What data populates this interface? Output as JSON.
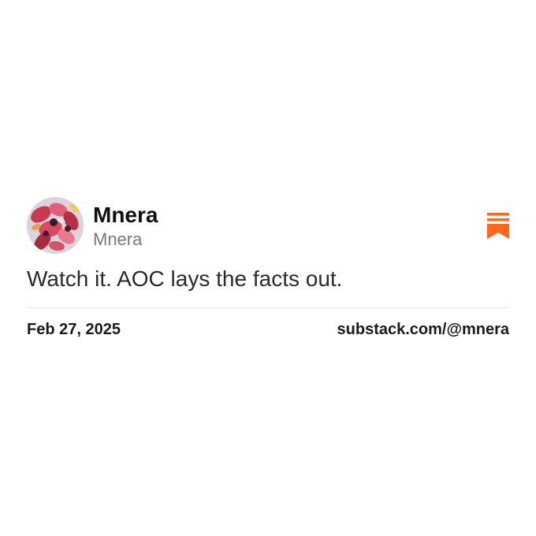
{
  "post": {
    "author_name": "Mnera",
    "author_handle": "Mnera",
    "text": "Watch it. AOC lays the facts out.",
    "date": "Feb 27, 2025",
    "source": "substack.com/@mnera"
  },
  "brand": {
    "icon": "substack-logo-icon",
    "color": "#FF6719"
  },
  "avatar": {
    "icon": "profile-avatar-flowers"
  }
}
